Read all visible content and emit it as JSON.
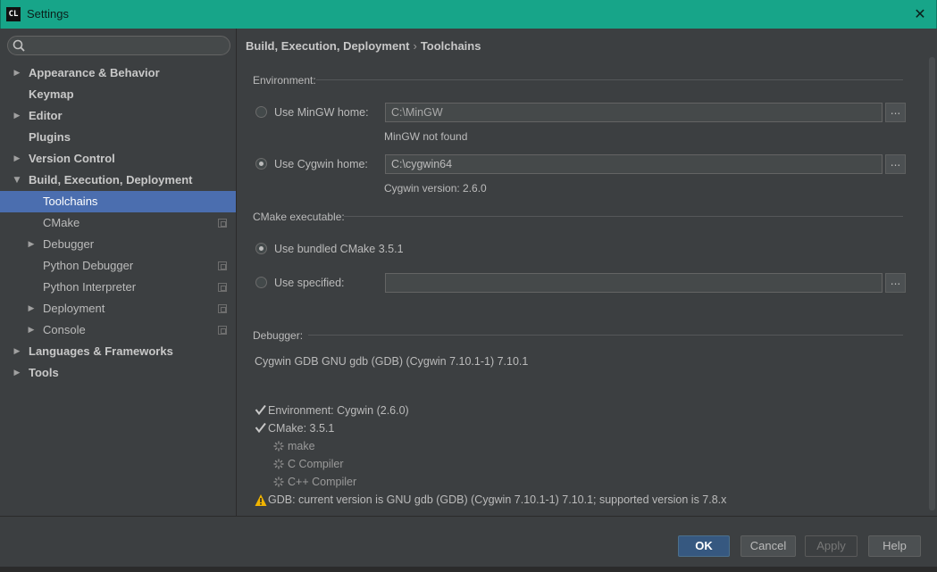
{
  "window": {
    "app_icon": "CL",
    "title": "Settings",
    "close_glyph": "✕"
  },
  "sidebar": {
    "search": {
      "value": "",
      "placeholder": ""
    },
    "items": [
      {
        "label": "Appearance & Behavior",
        "level": 0,
        "expandable": true,
        "expanded": false
      },
      {
        "label": "Keymap",
        "level": 0,
        "expandable": false
      },
      {
        "label": "Editor",
        "level": 0,
        "expandable": true,
        "expanded": false
      },
      {
        "label": "Plugins",
        "level": 0,
        "expandable": false
      },
      {
        "label": "Version Control",
        "level": 0,
        "expandable": true,
        "expanded": false
      },
      {
        "label": "Build, Execution, Deployment",
        "level": 0,
        "expandable": true,
        "expanded": true
      },
      {
        "label": "Toolchains",
        "level": 1,
        "selected": true
      },
      {
        "label": "CMake",
        "level": 1,
        "project_icon": true
      },
      {
        "label": "Debugger",
        "level": 1,
        "expandable": true
      },
      {
        "label": "Python Debugger",
        "level": 1,
        "project_icon": true
      },
      {
        "label": "Python Interpreter",
        "level": 1,
        "project_icon": true
      },
      {
        "label": "Deployment",
        "level": 1,
        "expandable": true,
        "project_icon": true
      },
      {
        "label": "Console",
        "level": 1,
        "expandable": true,
        "project_icon": true
      },
      {
        "label": "Languages & Frameworks",
        "level": 0,
        "expandable": true
      },
      {
        "label": "Tools",
        "level": 0,
        "expandable": true
      }
    ]
  },
  "breadcrumb": {
    "parent": "Build, Execution, Deployment",
    "separator": "›",
    "current": "Toolchains"
  },
  "environment": {
    "section_title": "Environment:",
    "mingw": {
      "label": "Use MinGW home:",
      "value": "C:\\MinGW",
      "status": "MinGW not found",
      "checked": false
    },
    "cygwin": {
      "label": "Use Cygwin home:",
      "value": "C:\\cygwin64",
      "status": "Cygwin version: 2.6.0",
      "checked": true
    },
    "browse_label": "..."
  },
  "cmake": {
    "section_title": "CMake executable:",
    "bundled": {
      "label": "Use bundled CMake 3.5.1",
      "checked": true
    },
    "specified": {
      "label": "Use specified:",
      "value": "",
      "checked": false
    }
  },
  "debugger": {
    "section_title": "Debugger:",
    "value": "Cygwin GDB GNU gdb (GDB) (Cygwin 7.10.1-1) 7.10.1"
  },
  "status": {
    "environment": "Environment: Cygwin (2.6.0)",
    "cmake": "CMake: 3.5.1",
    "make": "make",
    "c_compiler": "C Compiler",
    "cpp_compiler": "C++ Compiler",
    "gdb_warning": "GDB: current version is GNU gdb (GDB) (Cygwin 7.10.1-1) 7.10.1; supported version is 7.8.x"
  },
  "buttons": {
    "ok": "OK",
    "cancel": "Cancel",
    "apply": "Apply",
    "help": "Help"
  },
  "colors": {
    "titlebar": "#17a589",
    "selection": "#4b6eaf",
    "background": "#3c3f41",
    "warning": "#f0b400"
  }
}
